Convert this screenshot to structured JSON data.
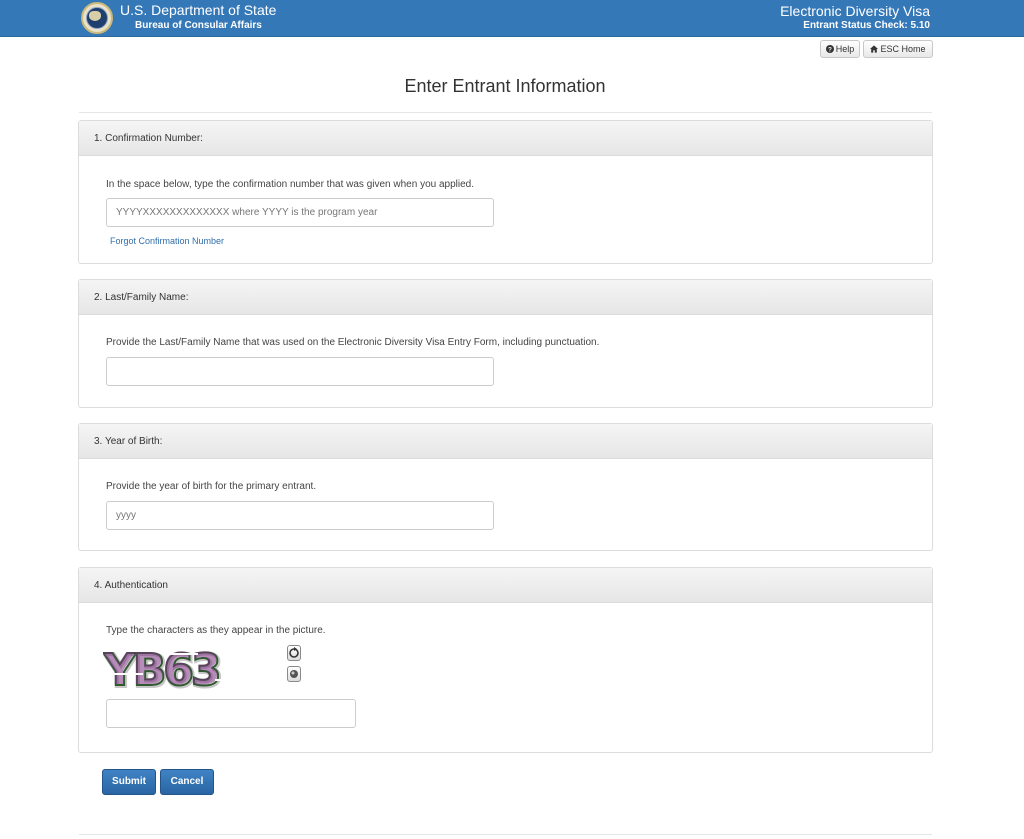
{
  "header": {
    "dept_title": "U.S. Department of State",
    "dept_subtitle": "Bureau of Consular Affairs",
    "app_title": "Electronic Diversity Visa",
    "app_subtitle": "Entrant Status Check: 5.10",
    "background_color": "#3478b8",
    "logo_icon": "state-department-seal"
  },
  "toolbar": {
    "help_label": "Help",
    "help_icon": "question-circle-icon",
    "home_label": "ESC Home",
    "home_icon": "home-icon"
  },
  "page": {
    "title": "Enter Entrant Information"
  },
  "sections": [
    {
      "heading": "1. Confirmation Number:",
      "instruction": "In the space below, type the confirmation number that was given when you applied.",
      "placeholder": "YYYYXXXXXXXXXXXXX where YYYY is the program year",
      "value": "",
      "link": "Forgot Confirmation Number"
    },
    {
      "heading": "2. Last/Family Name:",
      "instruction": "Provide the Last/Family Name that was used on the Electronic Diversity Visa Entry Form, including punctuation.",
      "placeholder": "",
      "value": ""
    },
    {
      "heading": "3. Year of Birth:",
      "instruction": "Provide the year of birth for the primary entrant.",
      "placeholder": "yyyy",
      "value": ""
    },
    {
      "heading": "4. Authentication",
      "instruction": "Type the characters as they appear in the picture.",
      "captcha_text": "YB63",
      "refresh_icon": "refresh-icon",
      "audio_icon": "audio-icon",
      "value": ""
    }
  ],
  "actions": {
    "submit_label": "Submit",
    "cancel_label": "Cancel",
    "button_color": "#2f6fae"
  }
}
